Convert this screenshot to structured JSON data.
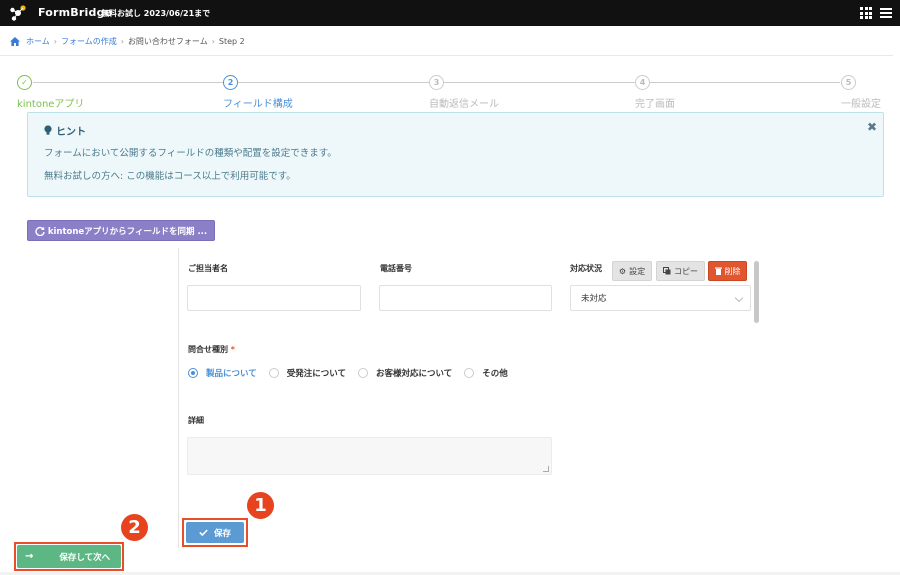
{
  "app": {
    "brand": "FormBridge",
    "trial": "無料お試し 2023/06/21まで",
    "icons": {
      "apps": "grid-icon",
      "menu": "hamburger-icon"
    }
  },
  "breadcrumb": {
    "home": "ホーム",
    "forms": "フォームの作成",
    "form_name": "お問い合わせフォーム",
    "step": "Step 2"
  },
  "steps": [
    {
      "marker": "✓",
      "label": "kintoneアプリ",
      "state": "done"
    },
    {
      "marker": "2",
      "label": "フィールド構成",
      "state": "active"
    },
    {
      "marker": "3",
      "label": "自動返信メール",
      "state": "todo"
    },
    {
      "marker": "4",
      "label": "完了画面",
      "state": "todo"
    },
    {
      "marker": "5",
      "label": "一般設定",
      "state": "todo"
    }
  ],
  "hint": {
    "title": "ヒント",
    "line1": "フォームにおいて公開するフィールドの種類や配置を設定できます。",
    "line2": "無料お試しの方へ: この機能はコース以上で利用可能です。",
    "close": "✖"
  },
  "sync_button": "kintoneアプリからフィールドを同期 ...",
  "fields": {
    "person": {
      "label": "ご担当者名",
      "value": ""
    },
    "phone": {
      "label": "電話番号",
      "value": ""
    },
    "status": {
      "label": "対応状況",
      "value": "未対応",
      "actions": {
        "settings": "設定",
        "copy": "コピー",
        "delete": "削除"
      }
    },
    "inquiry_type": {
      "label": "問合せ種別",
      "required_mark": "*",
      "options": [
        {
          "label": "製品について",
          "selected": true
        },
        {
          "label": "受発注について",
          "selected": false
        },
        {
          "label": "お客様対応について",
          "selected": false
        },
        {
          "label": "その他",
          "selected": false
        }
      ]
    },
    "details": {
      "label": "詳細",
      "value": ""
    }
  },
  "save_button": "保存",
  "save_next_button": "保存して次へ",
  "annotations": {
    "badge1": "1",
    "badge2": "2",
    "color": "#e8431f"
  },
  "colors": {
    "done": "#7cc04e",
    "active": "#4a90d9",
    "sync_button": "#8b7fc7",
    "save_button": "#5c9ad4",
    "save_next_button": "#5db784",
    "delete_button": "#e0562e"
  }
}
